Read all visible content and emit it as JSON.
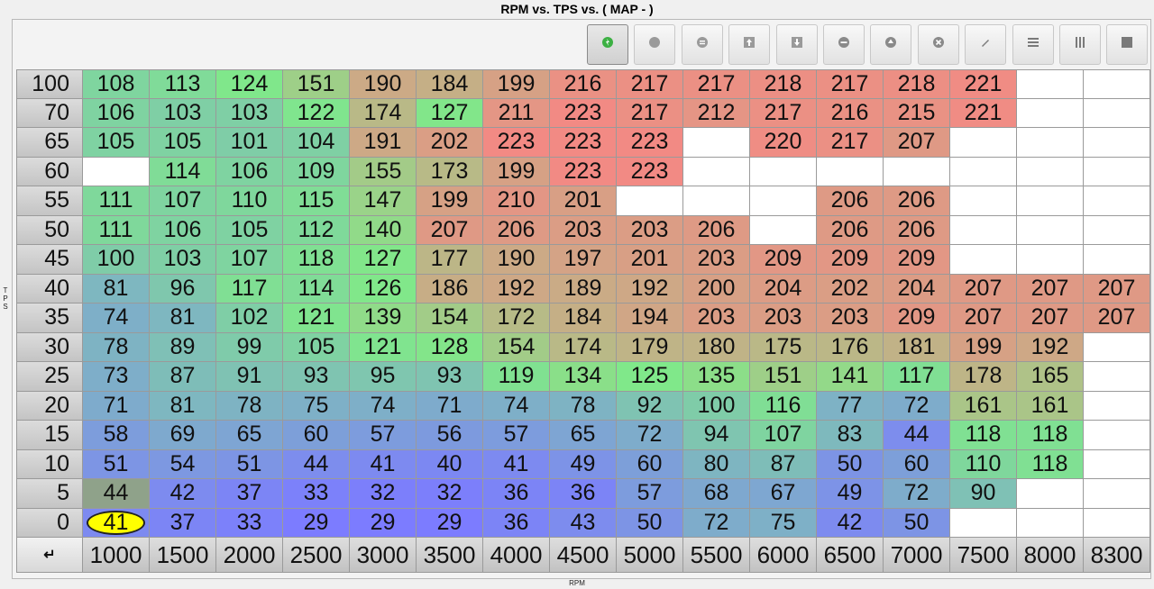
{
  "window": {
    "title": "RPM vs. TPS vs. ( MAP -   )"
  },
  "axes": {
    "y_label": "TPS",
    "x_label": "RPM"
  },
  "corner_label": "↵",
  "toolbar": [
    {
      "name": "wizard-icon",
      "color": "#3cb043",
      "active": true
    },
    {
      "name": "circle-icon",
      "color": "#9a9a9a",
      "active": false
    },
    {
      "name": "equals-icon",
      "color": "#9a9a9a",
      "active": false
    },
    {
      "name": "increase-icon",
      "color": "#9a9a9a",
      "active": false
    },
    {
      "name": "decrease-icon",
      "color": "#9a9a9a",
      "active": false
    },
    {
      "name": "minus-icon",
      "color": "#9a9a9a",
      "active": false
    },
    {
      "name": "plus-icon",
      "color": "#9a9a9a",
      "active": false
    },
    {
      "name": "clear-icon",
      "color": "#9a9a9a",
      "active": false
    },
    {
      "name": "pencil-icon",
      "color": "#9a9a9a",
      "active": false
    },
    {
      "name": "rows-icon",
      "color": "#9a9a9a",
      "active": false
    },
    {
      "name": "columns-icon",
      "color": "#9a9a9a",
      "active": false
    },
    {
      "name": "fill-icon",
      "color": "#9a9a9a",
      "active": false
    }
  ],
  "table": {
    "rpm": [
      "1000",
      "1500",
      "2000",
      "2500",
      "3000",
      "3500",
      "4000",
      "4500",
      "5000",
      "5500",
      "6000",
      "6500",
      "7000",
      "7500",
      "8000",
      "8300"
    ],
    "selected": {
      "tps": "0",
      "rpm": "1000",
      "value": "41"
    },
    "rows": [
      {
        "tps": "100",
        "values": [
          "108",
          "113",
          "124",
          "151",
          "190",
          "184",
          "199",
          "216",
          "217",
          "217",
          "218",
          "217",
          "218",
          "221",
          "",
          ""
        ]
      },
      {
        "tps": "70",
        "values": [
          "106",
          "103",
          "103",
          "122",
          "174",
          "127",
          "211",
          "223",
          "217",
          "212",
          "217",
          "216",
          "215",
          "221",
          "",
          ""
        ]
      },
      {
        "tps": "65",
        "values": [
          "105",
          "105",
          "101",
          "104",
          "191",
          "202",
          "223",
          "223",
          "223",
          "",
          "220",
          "217",
          "207",
          "",
          "",
          ""
        ]
      },
      {
        "tps": "60",
        "values": [
          "",
          "114",
          "106",
          "109",
          "155",
          "173",
          "199",
          "223",
          "223",
          "",
          "",
          "",
          "",
          "",
          "",
          ""
        ]
      },
      {
        "tps": "55",
        "values": [
          "111",
          "107",
          "110",
          "115",
          "147",
          "199",
          "210",
          "201",
          "",
          "",
          "",
          "206",
          "206",
          "",
          "",
          ""
        ]
      },
      {
        "tps": "50",
        "values": [
          "111",
          "106",
          "105",
          "112",
          "140",
          "207",
          "206",
          "203",
          "203",
          "206",
          "",
          "206",
          "206",
          "",
          "",
          ""
        ]
      },
      {
        "tps": "45",
        "values": [
          "100",
          "103",
          "107",
          "118",
          "127",
          "177",
          "190",
          "197",
          "201",
          "203",
          "209",
          "209",
          "209",
          "",
          "",
          ""
        ]
      },
      {
        "tps": "40",
        "values": [
          "81",
          "96",
          "117",
          "114",
          "126",
          "186",
          "192",
          "189",
          "192",
          "200",
          "204",
          "202",
          "204",
          "207",
          "207",
          "207"
        ]
      },
      {
        "tps": "35",
        "values": [
          "74",
          "81",
          "102",
          "121",
          "139",
          "154",
          "172",
          "184",
          "194",
          "203",
          "203",
          "203",
          "209",
          "207",
          "207",
          "207"
        ]
      },
      {
        "tps": "30",
        "values": [
          "78",
          "89",
          "99",
          "105",
          "121",
          "128",
          "154",
          "174",
          "179",
          "180",
          "175",
          "176",
          "181",
          "199",
          "192",
          ""
        ]
      },
      {
        "tps": "25",
        "values": [
          "73",
          "87",
          "91",
          "93",
          "95",
          "93",
          "119",
          "134",
          "125",
          "135",
          "151",
          "141",
          "117",
          "178",
          "165",
          ""
        ]
      },
      {
        "tps": "20",
        "values": [
          "71",
          "81",
          "78",
          "75",
          "74",
          "71",
          "74",
          "78",
          "92",
          "100",
          "116",
          "77",
          "72",
          "161",
          "161",
          ""
        ]
      },
      {
        "tps": "15",
        "values": [
          "58",
          "69",
          "65",
          "60",
          "57",
          "56",
          "57",
          "65",
          "72",
          "94",
          "107",
          "83",
          "44",
          "118",
          "118",
          ""
        ]
      },
      {
        "tps": "10",
        "values": [
          "51",
          "54",
          "51",
          "44",
          "41",
          "40",
          "41",
          "49",
          "60",
          "80",
          "87",
          "50",
          "60",
          "110",
          "118",
          ""
        ]
      },
      {
        "tps": "5",
        "values": [
          "44",
          "42",
          "37",
          "33",
          "32",
          "32",
          "36",
          "36",
          "57",
          "68",
          "67",
          "49",
          "72",
          "90",
          "",
          ""
        ]
      },
      {
        "tps": "0",
        "values": [
          "41",
          "37",
          "33",
          "29",
          "29",
          "29",
          "36",
          "43",
          "50",
          "72",
          "75",
          "42",
          "50",
          "",
          "",
          ""
        ]
      }
    ]
  },
  "colors": {
    "low": "#7c7cff",
    "mid": "#80e88a",
    "high": "#f28a84",
    "selected": "#ffff00",
    "tps5_rpm1000": "#8fa28a"
  }
}
